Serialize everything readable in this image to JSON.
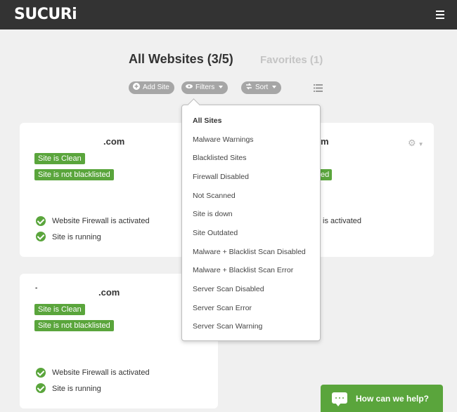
{
  "header": {
    "logo_text": "SUCURi",
    "menu_icon": "hamburger-icon"
  },
  "tabs": {
    "all": "All Websites (3/5)",
    "favorites": "Favorites (1)"
  },
  "toolbar": {
    "add_site": "Add Site",
    "filters": "Filters",
    "sort": "Sort"
  },
  "cards": [
    {
      "domain": ".com",
      "tags": [
        "Site is Clean",
        "Site is not blacklisted"
      ],
      "statuses": [
        "Website Firewall is activated",
        "Site is running"
      ]
    },
    {
      "domain": "m",
      "tag_partial": "ed",
      "status_partial": "is activated"
    },
    {
      "domain_prefix": "-",
      "domain": ".com",
      "tags": [
        "Site is Clean",
        "Site is not blacklisted"
      ],
      "statuses": [
        "Website Firewall is activated",
        "Site is running"
      ]
    }
  ],
  "filter_menu": {
    "items": [
      "All Sites",
      "Malware Warnings",
      "Blacklisted Sites",
      "Firewall Disabled",
      "Not Scanned",
      "Site is down",
      "Site Outdated",
      "Malware + Blacklist Scan Disabled",
      "Malware + Blacklist Scan Error",
      "Server Scan Disabled",
      "Server Scan Error",
      "Server Scan Warning"
    ],
    "selected": "All Sites"
  },
  "help": {
    "label": "How can we help?"
  },
  "colors": {
    "topbar": "#333333",
    "accent_green": "#5aa53c",
    "pill_gray": "#a6a6a6",
    "page_bg": "#f0f0f0"
  }
}
